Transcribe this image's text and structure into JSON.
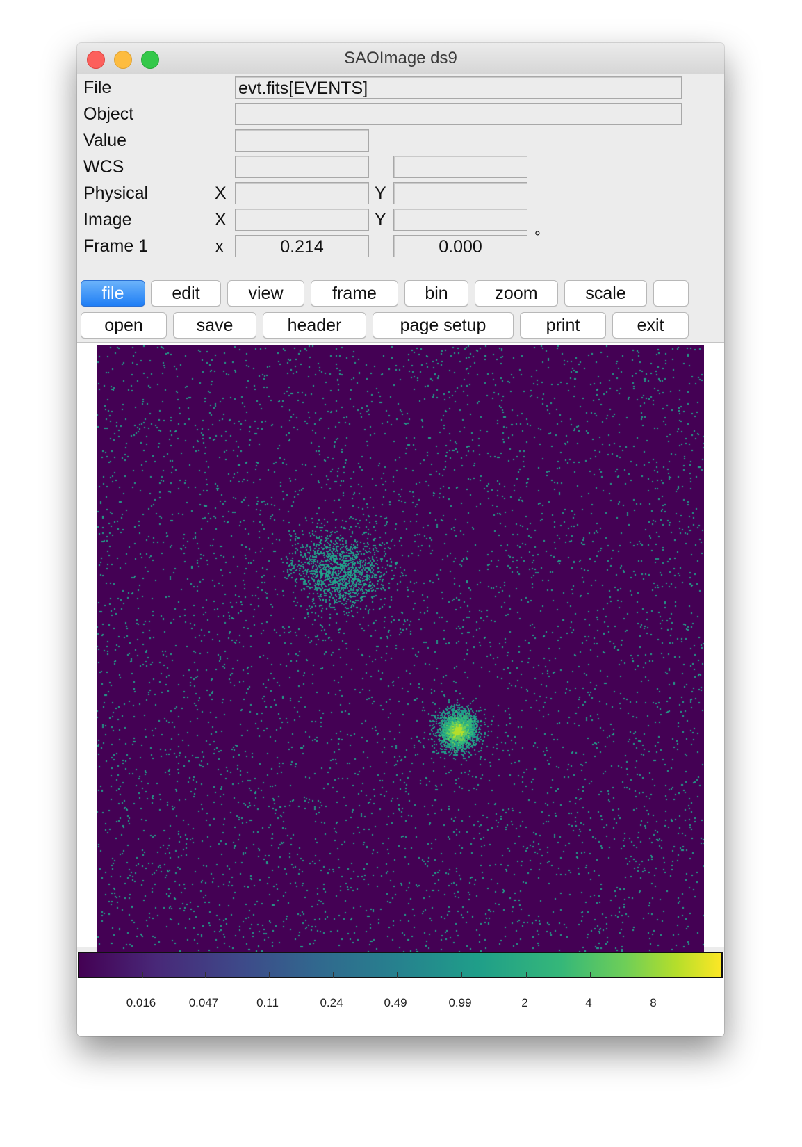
{
  "window": {
    "title": "SAOImage ds9"
  },
  "info": {
    "file": {
      "label": "File",
      "value": "evt.fits[EVENTS]"
    },
    "object": {
      "label": "Object",
      "value": ""
    },
    "value": {
      "label": "Value",
      "value": ""
    },
    "wcs": {
      "label": "WCS",
      "value1": "",
      "value2": ""
    },
    "physical": {
      "label": "Physical",
      "x_label": "X",
      "y_label": "Y",
      "x": "",
      "y": ""
    },
    "image": {
      "label": "Image",
      "x_label": "X",
      "y_label": "Y",
      "x": "",
      "y": ""
    },
    "frame": {
      "label": "Frame 1",
      "zoom_label": "x",
      "zoom": "0.214",
      "angle": "0.000",
      "angle_unit": "°"
    }
  },
  "menu": {
    "items": [
      "file",
      "edit",
      "view",
      "frame",
      "bin",
      "zoom",
      "scale",
      ""
    ],
    "active": "file"
  },
  "submenu": {
    "items": [
      "open",
      "save",
      "header",
      "page setup",
      "print",
      "exit"
    ]
  },
  "colorbar": {
    "colormap": "viridis",
    "tick_labels": [
      "0.016",
      "0.047",
      "0.11",
      "0.24",
      "0.49",
      "0.99",
      "2",
      "4",
      "8"
    ]
  },
  "colors": {
    "background": "#440154",
    "sparse_events": "#21a38a",
    "source_core": "#b5de2b",
    "active_button": "#1f7ef5"
  }
}
